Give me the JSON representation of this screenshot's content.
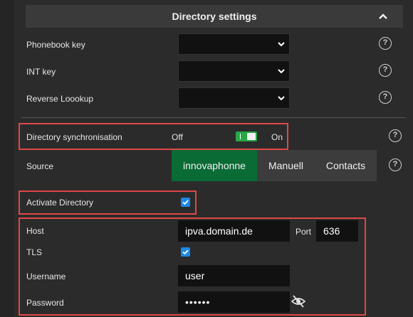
{
  "header": {
    "title": "Directory settings",
    "collapse_icon": "chevron-up-icon"
  },
  "keys": [
    {
      "label": "Phonebook key",
      "value": ""
    },
    {
      "label": "INT key",
      "value": ""
    },
    {
      "label": "Reverse Loookup",
      "value": ""
    }
  ],
  "sync": {
    "label": "Directory synchronisation",
    "off_label": "Off",
    "on_label": "On",
    "state": "on"
  },
  "source": {
    "label": "Source",
    "options": [
      "innovaphonne",
      "Manuell",
      "Contacts"
    ],
    "selected": "innovaphonne"
  },
  "activate": {
    "label": "Activate Directory",
    "checked": true
  },
  "connection": {
    "host_label": "Host",
    "host_value": "ipva.domain.de",
    "port_label": "Port",
    "port_value": "636",
    "tls_label": "TLS",
    "tls_checked": true,
    "username_label": "Username",
    "username_value": "user",
    "password_label": "Password",
    "password_value": "••••••"
  },
  "help_symbol": "?",
  "colors": {
    "accent_green": "#0b6b35",
    "toggle_green": "#28a745",
    "highlight_red": "#e04848",
    "checkbox_blue": "#1e88e5"
  }
}
